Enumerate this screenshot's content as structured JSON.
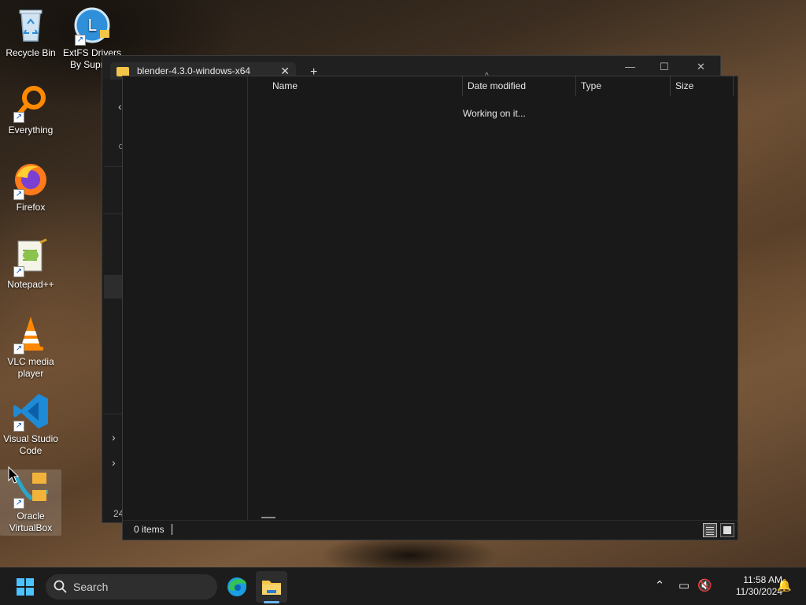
{
  "desktop": {
    "icons": [
      {
        "label": "Recycle Bin",
        "name": "recycle-bin"
      },
      {
        "label": "ExtFS Drivers By Supren",
        "name": "extfs-drivers"
      },
      {
        "label": "Everything",
        "name": "everything"
      },
      {
        "label": "Firefox",
        "name": "firefox"
      },
      {
        "label": "Notepad++",
        "name": "notepad-plus-plus"
      },
      {
        "label": "VLC media player",
        "name": "vlc-media-player"
      },
      {
        "label": "Visual Studio Code",
        "name": "visual-studio-code"
      },
      {
        "label": "Oracle VirtualBox",
        "name": "oracle-virtualbox"
      }
    ]
  },
  "background_window": {
    "tab_title": "blender-4.3.0-windows-x64",
    "tab_close": "✕",
    "new_tab": "+",
    "minimize": "—",
    "maximize": "☐",
    "close": "✕",
    "item_count_partial": "24"
  },
  "dialog": {
    "columns": {
      "name": "Name",
      "date_modified": "Date modified",
      "type": "Type",
      "size": "Size"
    },
    "status_message": "Working on it...",
    "items_count": "0 items"
  },
  "taskbar": {
    "search_placeholder": "Search",
    "time": "11:58 AM",
    "date": "11/30/2024"
  }
}
